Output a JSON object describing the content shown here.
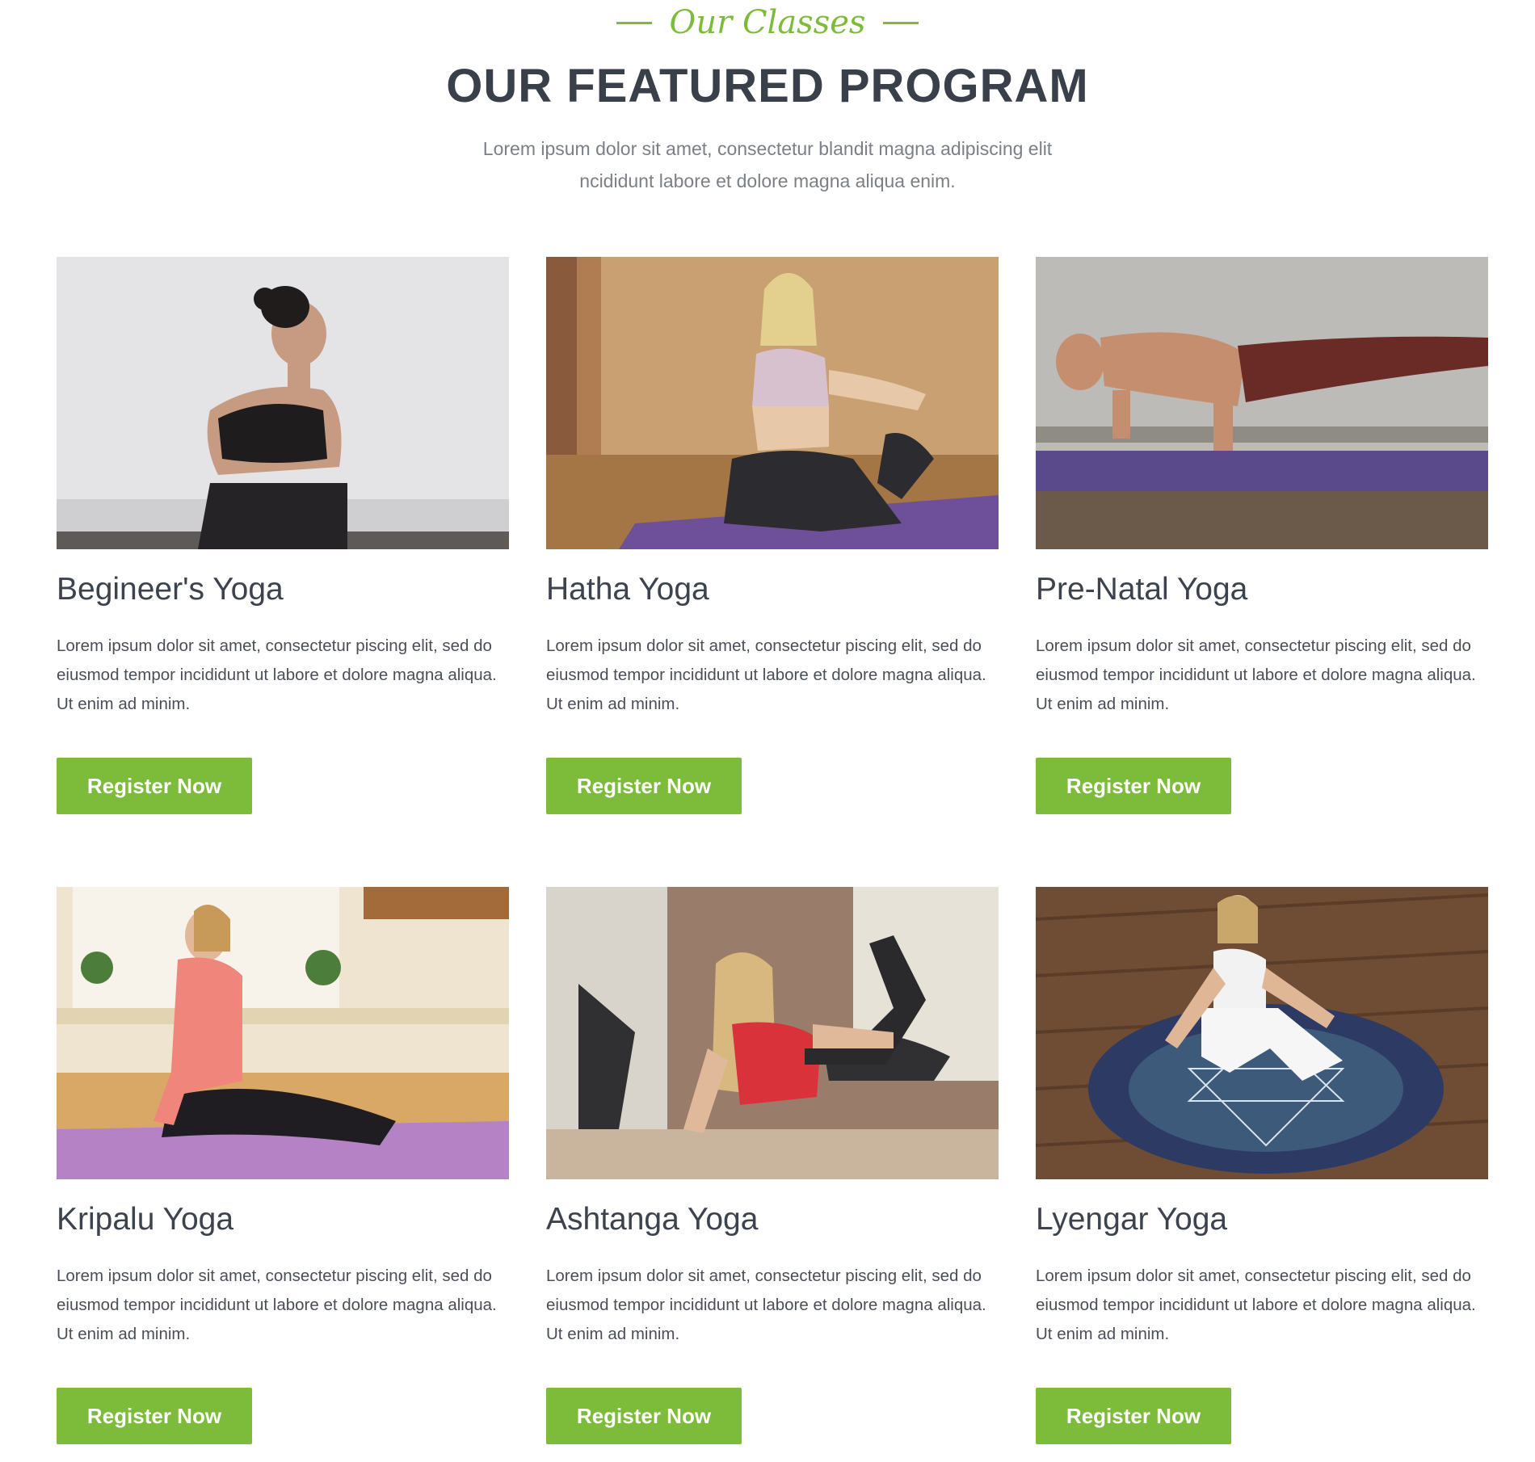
{
  "header": {
    "eyebrow": "Our Classes",
    "title": "OUR FEATURED PROGRAM",
    "intro": "Lorem ipsum dolor sit amet, consectetur blandit magna adipiscing elit ncididunt labore et dolore magna aliqua enim."
  },
  "colors": {
    "accent": "#7dbb3a",
    "heading": "#3a404a",
    "body_text": "#4a4f57",
    "muted_text": "#7b8087"
  },
  "programs": [
    {
      "title": "Begineer's Yoga",
      "description": "Lorem ipsum dolor sit amet, consectetur piscing elit, sed do eiusmod tempor incididunt ut labore et dolore magna aliqua. Ut enim ad minim.",
      "button_label": "Register Now"
    },
    {
      "title": "Hatha Yoga",
      "description": "Lorem ipsum dolor sit amet, consectetur piscing elit, sed do eiusmod tempor incididunt ut labore et dolore magna aliqua. Ut enim ad minim.",
      "button_label": "Register Now"
    },
    {
      "title": "Pre-Natal Yoga",
      "description": "Lorem ipsum dolor sit amet, consectetur piscing elit, sed do eiusmod tempor incididunt ut labore et dolore magna aliqua. Ut enim ad minim.",
      "button_label": "Register Now"
    },
    {
      "title": "Kripalu Yoga",
      "description": "Lorem ipsum dolor sit amet, consectetur piscing elit, sed do eiusmod tempor incididunt ut labore et dolore magna aliqua. Ut enim ad minim.",
      "button_label": "Register Now"
    },
    {
      "title": "Ashtanga Yoga",
      "description": "Lorem ipsum dolor sit amet, consectetur piscing elit, sed do eiusmod tempor incididunt ut labore et dolore magna aliqua. Ut enim ad minim.",
      "button_label": "Register Now"
    },
    {
      "title": "Lyengar Yoga",
      "description": "Lorem ipsum dolor sit amet, consectetur piscing elit, sed do eiusmod tempor incididunt ut labore et dolore magna aliqua. Ut enim ad minim.",
      "button_label": "Register Now"
    }
  ]
}
